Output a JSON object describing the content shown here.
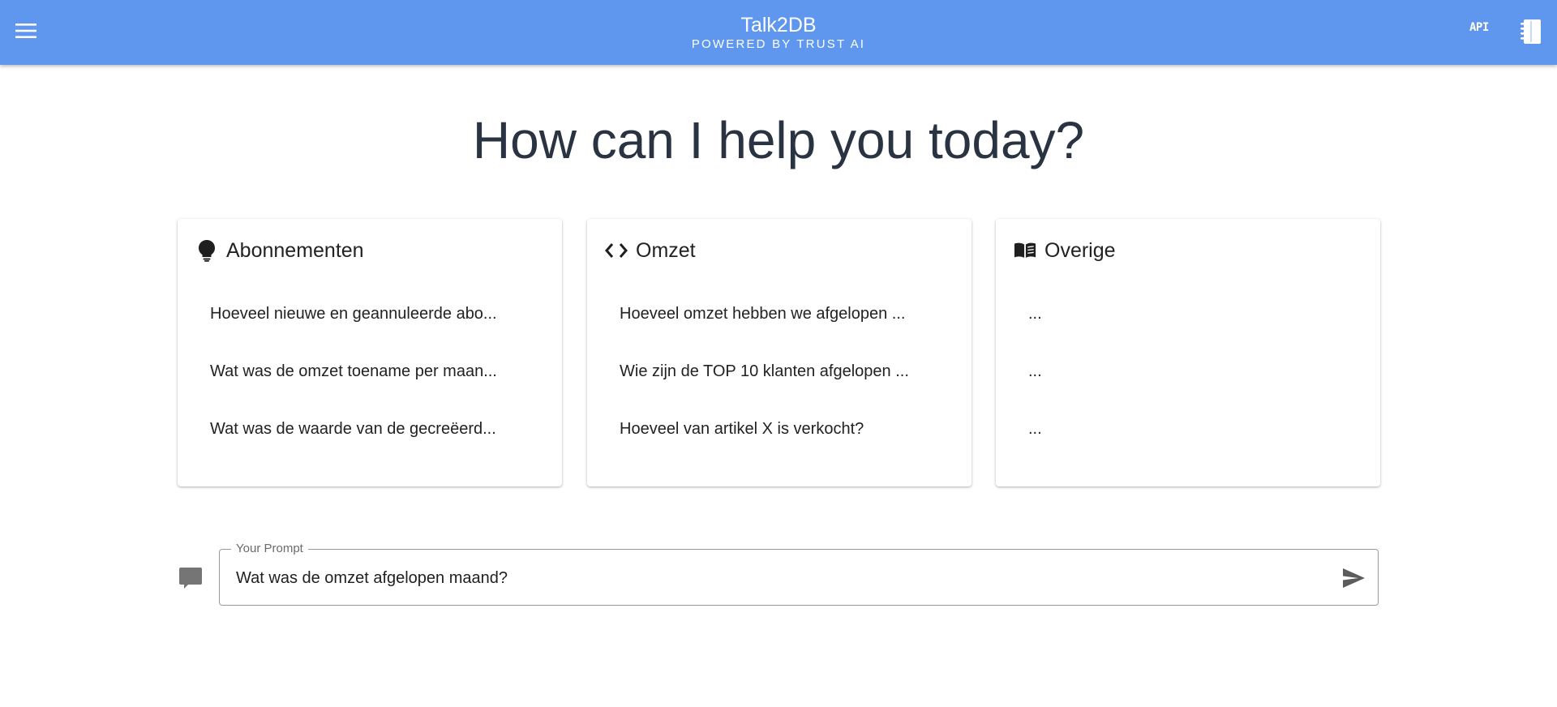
{
  "header": {
    "title": "Talk2DB",
    "subtitle": "POWERED BY TRUST AI",
    "api_label": "API",
    "bg_color": "#5f97ee"
  },
  "icons": {
    "menu": "hamburger-menu-icon",
    "notebook": "notebook-icon",
    "lightbulb": "lightbulb-icon",
    "code": "code-brackets-icon",
    "book": "open-book-icon",
    "comment": "comment-icon",
    "send": "send-icon"
  },
  "main": {
    "heading": "How can I help you today?"
  },
  "cards": [
    {
      "title": "Abonnementen",
      "items": [
        "Hoeveel nieuwe en geannuleerde abo...",
        "Wat was de omzet toename per maan...",
        "Wat was de waarde van de gecreëerd..."
      ]
    },
    {
      "title": "Omzet",
      "items": [
        "Hoeveel omzet hebben we afgelopen ...",
        "Wie zijn de TOP 10 klanten afgelopen ...",
        "Hoeveel van artikel X is verkocht?"
      ]
    },
    {
      "title": "Overige",
      "items": [
        "...",
        "...",
        "..."
      ]
    }
  ],
  "prompt": {
    "label": "Your Prompt",
    "value": "Wat was de omzet afgelopen maand?"
  }
}
